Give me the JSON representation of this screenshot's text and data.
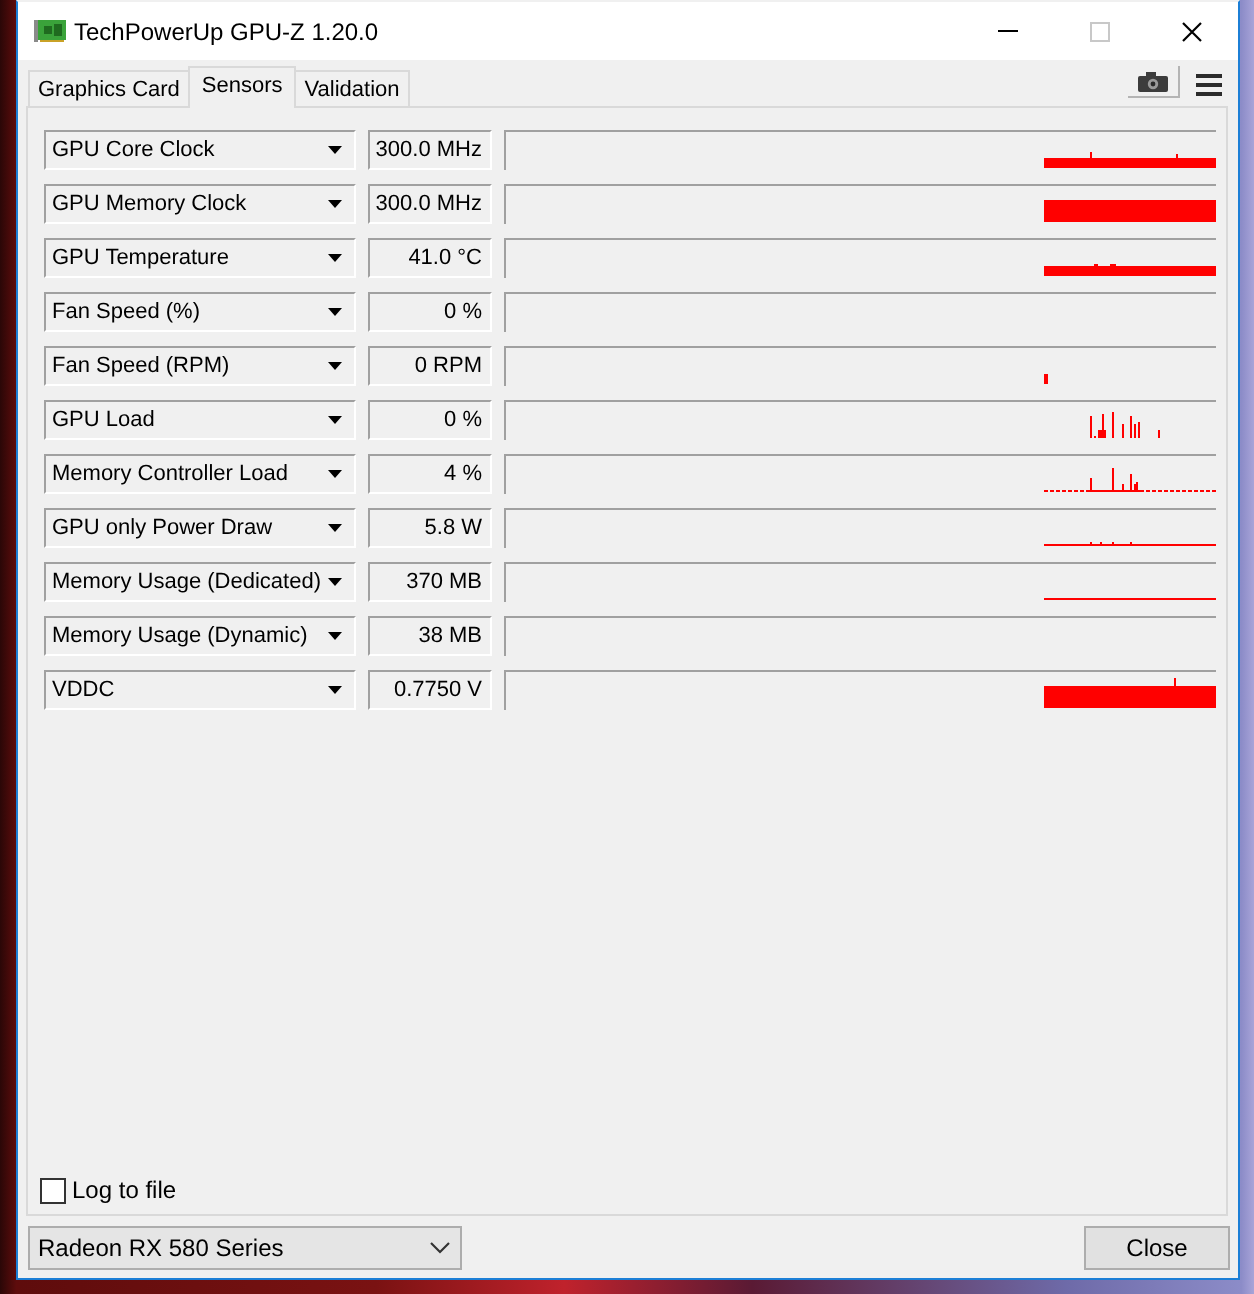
{
  "window": {
    "title": "TechPowerUp GPU-Z 1.20.0",
    "controls": [
      {
        "kind": "minimize",
        "disabled": false
      },
      {
        "kind": "maximize",
        "disabled": true
      },
      {
        "kind": "close",
        "disabled": false
      }
    ]
  },
  "tabs": [
    {
      "label": "Graphics Card",
      "selected": false
    },
    {
      "label": "Sensors",
      "selected": true
    },
    {
      "label": "Validation",
      "selected": false
    }
  ],
  "sensors": [
    {
      "name": "GPU Core Clock",
      "value": "300.0 MHz"
    },
    {
      "name": "GPU Memory Clock",
      "value": "300.0 MHz"
    },
    {
      "name": "GPU Temperature",
      "value": "41.0 °C"
    },
    {
      "name": "Fan Speed (%)",
      "value": "0 %"
    },
    {
      "name": "Fan Speed (RPM)",
      "value": "0 RPM"
    },
    {
      "name": "GPU Load",
      "value": "0 %"
    },
    {
      "name": "Memory Controller Load",
      "value": "4 %"
    },
    {
      "name": "GPU only Power Draw",
      "value": "5.8 W"
    },
    {
      "name": "Memory Usage (Dedicated)",
      "value": "370 MB"
    },
    {
      "name": "Memory Usage (Dynamic)",
      "value": "38 MB"
    },
    {
      "name": "VDDC",
      "value": "0.7750 V"
    }
  ],
  "log_to_file": {
    "label": "Log to file",
    "checked": false
  },
  "device_select": {
    "value": "Radeon RX 580 Series"
  },
  "close_button": {
    "label": "Close"
  }
}
